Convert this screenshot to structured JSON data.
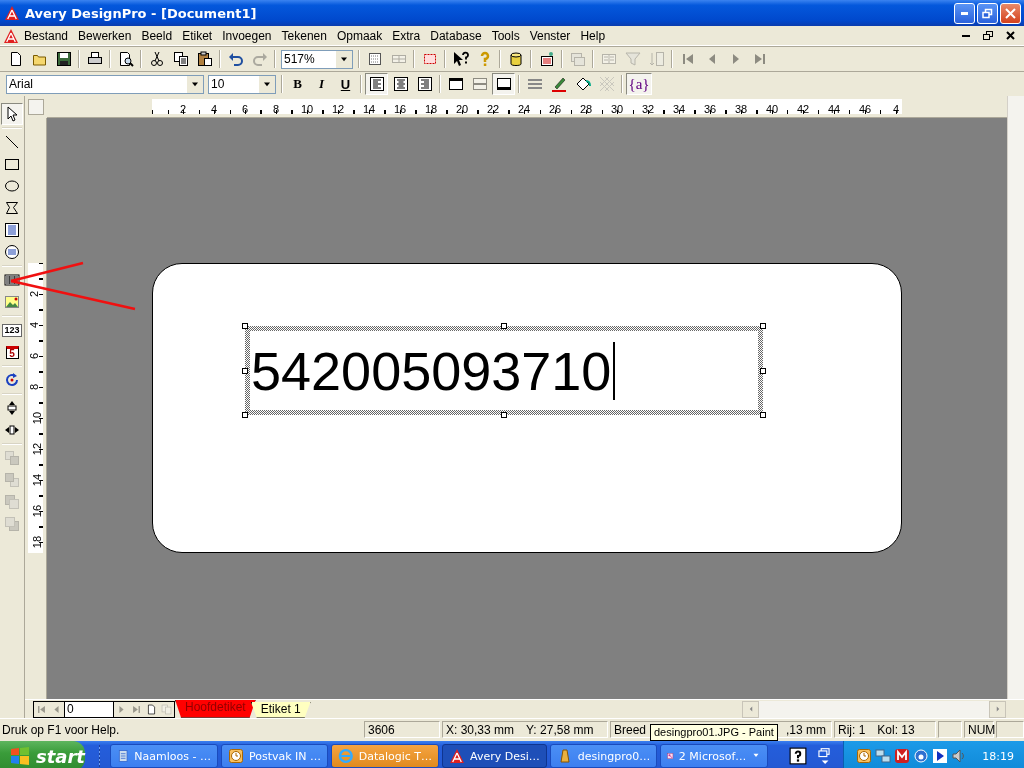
{
  "window": {
    "title": "Avery DesignPro - [Document1]"
  },
  "menu": {
    "items": [
      "Bestand",
      "Bewerken",
      "Beeld",
      "Etiket",
      "Invoegen",
      "Tekenen",
      "Opmaak",
      "Extra",
      "Database",
      "Tools",
      "Venster",
      "Help"
    ]
  },
  "toolbar": {
    "groups": [
      [
        {
          "kind": "new",
          "disabled": false
        },
        {
          "kind": "open",
          "disabled": false
        },
        {
          "kind": "save",
          "disabled": false
        }
      ],
      [
        {
          "kind": "print",
          "disabled": false
        }
      ],
      [
        {
          "kind": "preview",
          "disabled": false
        }
      ],
      [
        {
          "kind": "cut",
          "disabled": false
        },
        {
          "kind": "copy",
          "disabled": false
        },
        {
          "kind": "paste",
          "disabled": false
        }
      ],
      [
        {
          "kind": "undo",
          "disabled": false
        },
        {
          "kind": "redo",
          "disabled": true
        }
      ],
      [
        {
          "kind": "combo",
          "value": "517%"
        }
      ],
      [
        {
          "kind": "grid",
          "disabled": false
        },
        {
          "kind": "grid2",
          "disabled": true
        }
      ],
      [
        {
          "kind": "object",
          "disabled": false
        }
      ],
      [
        {
          "kind": "whatsthis",
          "disabled": false
        },
        {
          "kind": "help",
          "disabled": false
        }
      ],
      [
        {
          "kind": "database",
          "disabled": false
        }
      ],
      [
        {
          "kind": "merge",
          "disabled": false
        }
      ],
      [
        {
          "kind": "record",
          "disabled": true
        }
      ],
      [
        {
          "kind": "table",
          "disabled": true
        },
        {
          "kind": "filter",
          "disabled": true
        },
        {
          "kind": "sort",
          "disabled": true
        }
      ],
      [
        {
          "kind": "first",
          "disabled": true
        },
        {
          "kind": "prev",
          "disabled": true
        },
        {
          "kind": "next",
          "disabled": true
        },
        {
          "kind": "last",
          "disabled": true
        }
      ]
    ]
  },
  "format_bar": {
    "font": "Arial",
    "size": "10",
    "groups": [
      [
        {
          "kind": "bold",
          "label": "B",
          "pressed": false
        },
        {
          "kind": "italic",
          "label": "I",
          "pressed": false
        },
        {
          "kind": "underline",
          "label": "U",
          "pressed": false
        }
      ],
      [
        {
          "kind": "align-left",
          "pressed": true
        },
        {
          "kind": "align-center",
          "pressed": false
        },
        {
          "kind": "align-right",
          "pressed": false
        }
      ],
      [
        {
          "kind": "valign-top",
          "pressed": false
        },
        {
          "kind": "valign-middle",
          "pressed": false,
          "disabled": true
        },
        {
          "kind": "valign-bottom",
          "pressed": true
        }
      ],
      [
        {
          "kind": "line-style",
          "pressed": false
        },
        {
          "kind": "pen",
          "pressed": false
        },
        {
          "kind": "fill",
          "pressed": false
        },
        {
          "kind": "pattern",
          "pressed": false,
          "disabled": true
        }
      ],
      [
        {
          "kind": "merge-field",
          "label": "{a}",
          "pressed": true
        }
      ]
    ]
  },
  "tools": {
    "groups": [
      [
        {
          "kind": "pointer",
          "pressed": true
        }
      ],
      [
        {
          "kind": "line",
          "pressed": false
        },
        {
          "kind": "rectangle",
          "pressed": false
        },
        {
          "kind": "ellipse",
          "pressed": false
        },
        {
          "kind": "polygon",
          "pressed": false
        },
        {
          "kind": "paragraph",
          "pressed": false
        },
        {
          "kind": "arc-text",
          "pressed": false
        }
      ],
      [
        {
          "kind": "barcode",
          "pressed": false
        },
        {
          "kind": "picture",
          "pressed": false
        }
      ],
      [
        {
          "kind": "numbering",
          "label": "123",
          "pressed": false
        },
        {
          "kind": "date",
          "label": "5",
          "pressed": false
        }
      ],
      [
        {
          "kind": "rotate",
          "pressed": false
        }
      ],
      [
        {
          "kind": "flip-v",
          "pressed": false
        },
        {
          "kind": "flip-h",
          "pressed": false
        }
      ],
      [
        {
          "kind": "front",
          "pressed": false,
          "disabled": true
        },
        {
          "kind": "back",
          "pressed": false,
          "disabled": true
        },
        {
          "kind": "forward",
          "pressed": false,
          "disabled": true
        },
        {
          "kind": "backward",
          "pressed": false,
          "disabled": true
        }
      ]
    ]
  },
  "ruler": {
    "horizontal": [
      "2",
      "4",
      "6",
      "8",
      "10",
      "12",
      "14",
      "16",
      "18",
      "20",
      "22",
      "24",
      "26",
      "28",
      "30",
      "32",
      "34",
      "36",
      "38",
      "40",
      "42",
      "44",
      "46",
      "4"
    ],
    "vertical": [
      "2",
      "4",
      "6",
      "8",
      "10",
      "12",
      "14",
      "16",
      "18"
    ]
  },
  "label": {
    "text": "542005093710"
  },
  "page_nav": {
    "page": "0",
    "buttons": [
      {
        "kind": "first",
        "disabled": true
      },
      {
        "kind": "prev",
        "disabled": true
      },
      {
        "kind": "field"
      },
      {
        "kind": "next",
        "disabled": true
      },
      {
        "kind": "last",
        "disabled": true
      },
      {
        "kind": "new-page",
        "disabled": false
      },
      {
        "kind": "copy-page",
        "disabled": true
      }
    ]
  },
  "sheet_tabs": [
    {
      "label": "Hoofdetiket",
      "selected": true,
      "color": "#ff0000"
    },
    {
      "label": "Etiket 1",
      "selected": false,
      "color": "#ffffc0"
    }
  ],
  "status_bar": {
    "message": "Druk op F1 voor Help.",
    "fields": [
      {
        "kind": "text",
        "texts": [
          "3606"
        ]
      },
      {
        "kind": "text",
        "texts": [
          "X: 30,33 mm",
          "Y: 27,58 mm"
        ]
      },
      {
        "kind": "covered",
        "texts": [
          "Breed",
          ",13 mm"
        ]
      },
      {
        "kind": "text",
        "texts": [
          "Rij: 1",
          "Kol: 13"
        ]
      },
      {
        "kind": "blank"
      },
      {
        "kind": "text",
        "texts": [
          "NUM"
        ]
      },
      {
        "kind": "blank"
      }
    ]
  },
  "tooltip": {
    "text": "desingpro01.JPG - Paint"
  },
  "taskbar": {
    "start": "start",
    "tasks": [
      {
        "kind": "notepad",
        "label": "Naamloos - …",
        "selected": false,
        "flashing": false,
        "grouped": false
      },
      {
        "kind": "outlook",
        "label": "Postvak IN …",
        "selected": false,
        "flashing": false,
        "grouped": false
      },
      {
        "kind": "browser",
        "label": "Datalogic T…",
        "selected": false,
        "flashing": true,
        "grouped": false
      },
      {
        "kind": "avery",
        "label": "Avery Desi…",
        "selected": true,
        "flashing": false,
        "grouped": false
      },
      {
        "kind": "paint",
        "label": "desingpro0…",
        "selected": false,
        "flashing": false,
        "grouped": false
      },
      {
        "kind": "key",
        "label": "2 Microsof…",
        "selected": false,
        "flashing": false,
        "grouped": true
      }
    ],
    "clock": "18:19"
  }
}
